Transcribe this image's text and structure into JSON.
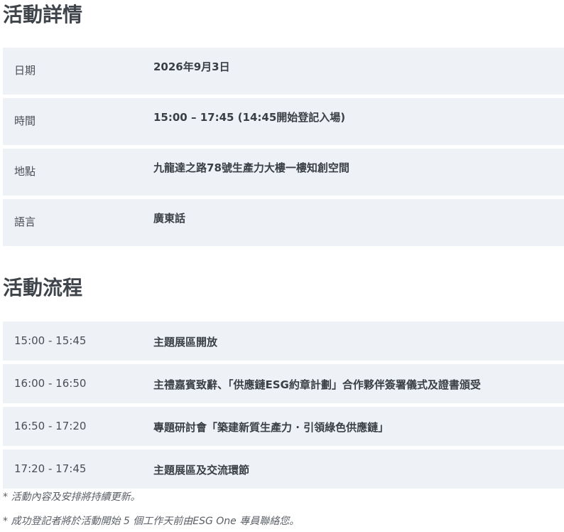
{
  "details": {
    "title": "活動詳情",
    "rows": [
      {
        "label": "日期",
        "value": "2026年9月3日"
      },
      {
        "label": "時間",
        "value": "15:00 – 17:45 (14:45開始登記入場)"
      },
      {
        "label": "地點",
        "value": "九龍達之路78號生產力大樓一樓知創空間"
      },
      {
        "label": "語言",
        "value": "廣東話"
      }
    ]
  },
  "schedule": {
    "title": "活動流程",
    "rows": [
      {
        "time": "15:00 - 15:45",
        "item": "主題展區開放"
      },
      {
        "time": "16:00 - 16:50",
        "item": "主禮嘉賓致辭、「供應鏈ESG約章計劃」合作夥伴簽署儀式及證書頒受"
      },
      {
        "time": "16:50 - 17:20",
        "item": "專題研討會「築建新質生產力 · 引領綠色供應鏈」"
      },
      {
        "time": "17:20 - 17:45",
        "item": "主題展區及交流環節"
      }
    ]
  },
  "notes": [
    "* 活動內容及安排將持續更新。",
    "* 成功登記者將於活動開始 5 個工作天前由ESG One 專員聯絡您。"
  ]
}
